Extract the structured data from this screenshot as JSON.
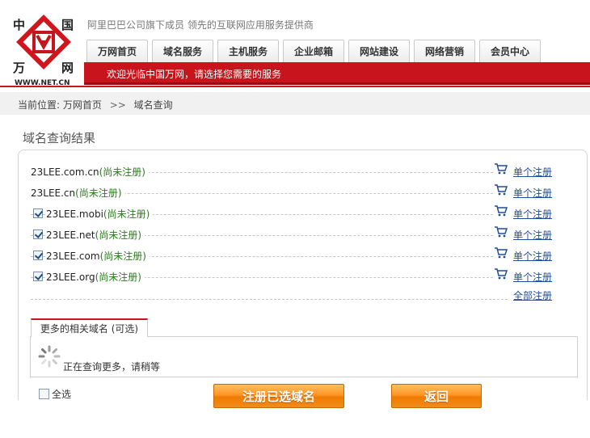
{
  "logo": {
    "top_left": "中",
    "top_right": "国",
    "bottom_left": "万",
    "bottom_right": "网",
    "domain": "WWW.NET.CN"
  },
  "header": {
    "slogan": "阿里巴巴公司旗下成员   领先的互联网应用服务提供商",
    "welcome": "欢迎光临中国万网，请选择您需要的服务"
  },
  "nav": {
    "tabs": [
      "万网首页",
      "域名服务",
      "主机服务",
      "企业邮箱",
      "网站建设",
      "网络营销",
      "会员中心"
    ]
  },
  "breadcrumb": {
    "prefix": "当前位置: 万网首页",
    "separator": ">>",
    "current": "域名查询"
  },
  "section_title": "域名查询结果",
  "results": [
    {
      "domain": "23LEE.com.cn",
      "status": "(尚未注册)",
      "checkbox": false,
      "link": "单个注册"
    },
    {
      "domain": "23LEE.cn",
      "status": "(尚未注册)",
      "checkbox": false,
      "link": "单个注册"
    },
    {
      "domain": "23LEE.mobi",
      "status": "(尚未注册)",
      "checkbox": true,
      "link": "单个注册"
    },
    {
      "domain": "23LEE.net",
      "status": "(尚未注册)",
      "checkbox": true,
      "link": "单个注册"
    },
    {
      "domain": "23LEE.com",
      "status": "(尚未注册)",
      "checkbox": true,
      "link": "单个注册"
    },
    {
      "domain": "23LEE.org",
      "status": "(尚未注册)",
      "checkbox": true,
      "link": "单个注册"
    }
  ],
  "register_all": "全部注册",
  "more": {
    "tab_label": "更多的相关域名 (可选)",
    "loading_text": "正在查询更多，请稍等"
  },
  "controls": {
    "select_all": "全选",
    "register_selected": "注册已选域名",
    "back": "返回"
  },
  "colors": {
    "brand_red": "#c8151d",
    "available_green": "#2c7a1f",
    "link_blue": "#1f4d9a",
    "button_orange": "#ff9526"
  },
  "icons": {
    "cart": "shopping-cart-icon",
    "spinner": "loading-spinner-icon",
    "checkbox": "checkbox-checked-icon"
  }
}
